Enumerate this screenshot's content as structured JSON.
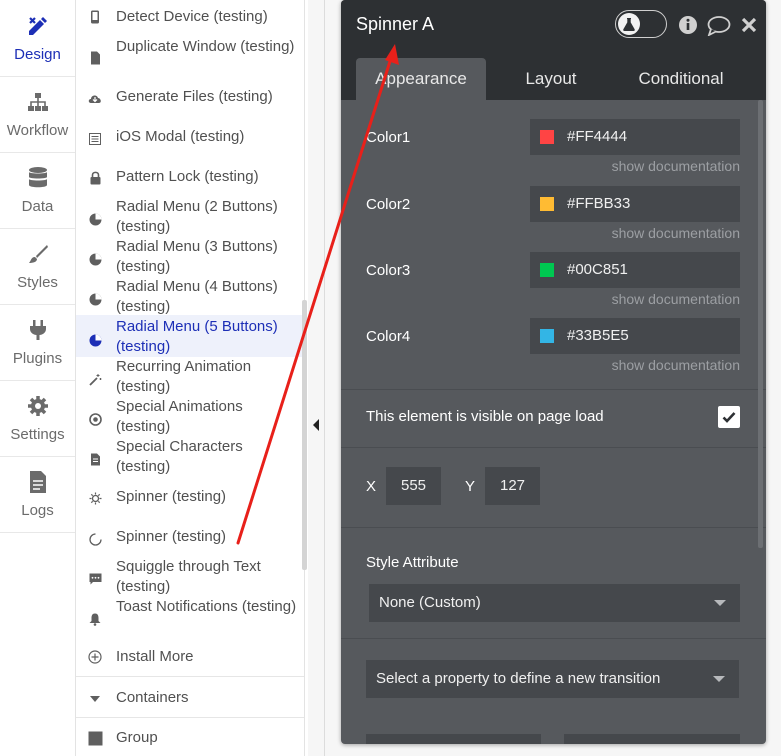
{
  "left_nav": {
    "items": [
      {
        "label": "Design",
        "icon": "design-icon",
        "active": true
      },
      {
        "label": "Workflow",
        "icon": "workflow-icon"
      },
      {
        "label": "Data",
        "icon": "database-icon"
      },
      {
        "label": "Styles",
        "icon": "brush-icon"
      },
      {
        "label": "Plugins",
        "icon": "plug-icon"
      },
      {
        "label": "Settings",
        "icon": "gear-icon"
      },
      {
        "label": "Logs",
        "icon": "document-icon"
      }
    ]
  },
  "element_list": {
    "items": [
      {
        "label": "Detect Device (testing)",
        "icon": "phone-icon"
      },
      {
        "label": "Duplicate Window (testing)",
        "icon": "file-icon"
      },
      {
        "label": "Generate Files (testing)",
        "icon": "cloud-download-icon"
      },
      {
        "label": "iOS Modal (testing)",
        "icon": "list-icon"
      },
      {
        "label": "Pattern Lock (testing)",
        "icon": "lock-icon"
      },
      {
        "label": "Radial Menu (2 Buttons) (testing)",
        "icon": "pie-icon"
      },
      {
        "label": "Radial Menu (3 Buttons) (testing)",
        "icon": "pie-icon"
      },
      {
        "label": "Radial Menu (4 Buttons) (testing)",
        "icon": "pie-icon"
      },
      {
        "label": "Radial Menu (5 Buttons) (testing)",
        "icon": "pie-icon",
        "selected": true
      },
      {
        "label": "Recurring Animation (testing)",
        "icon": "magic-wand-icon"
      },
      {
        "label": "Special Animations (testing)",
        "icon": "target-icon"
      },
      {
        "label": "Special Characters (testing)",
        "icon": "file-text-icon"
      },
      {
        "label": "Spinner (testing)",
        "icon": "sun-icon"
      },
      {
        "label": "Spinner (testing)",
        "icon": "circle-icon"
      },
      {
        "label": "Squiggle through Text (testing)",
        "icon": "chat-dots-icon"
      },
      {
        "label": "Toast Notifications (testing)",
        "icon": "bell-icon"
      },
      {
        "label": "Install More",
        "icon": "plus-circle-icon"
      }
    ],
    "section": {
      "label": "Containers",
      "icon": "caret-down-icon"
    },
    "group": {
      "label": "Group",
      "icon": "square-icon"
    }
  },
  "property_editor": {
    "title": "Spinner A",
    "tabs": [
      {
        "label": "Appearance",
        "active": true
      },
      {
        "label": "Layout"
      },
      {
        "label": "Conditional"
      }
    ],
    "colors": [
      {
        "label": "Color1",
        "value": "#FF4444",
        "swatch": "#FF4444",
        "doc": "show documentation"
      },
      {
        "label": "Color2",
        "value": "#FFBB33",
        "swatch": "#FFBB33",
        "doc": "show documentation"
      },
      {
        "label": "Color3",
        "value": "#00C851",
        "swatch": "#00C851",
        "doc": "show documentation"
      },
      {
        "label": "Color4",
        "value": "#33B5E5",
        "swatch": "#33B5E5",
        "doc": "show documentation"
      }
    ],
    "visible_label": "This element is visible on page load",
    "visible_checked": true,
    "x_label": "X",
    "x_value": "555",
    "y_label": "Y",
    "y_value": "127",
    "style_label": "Style Attribute",
    "style_value": "None (Custom)",
    "transition_placeholder": "Select a property to define a new transition"
  },
  "colors": {
    "accent": "#1D2FB6",
    "panel_dark": "#2D3033",
    "panel": "#56595D",
    "annotation_arrow": "#E8201A"
  }
}
